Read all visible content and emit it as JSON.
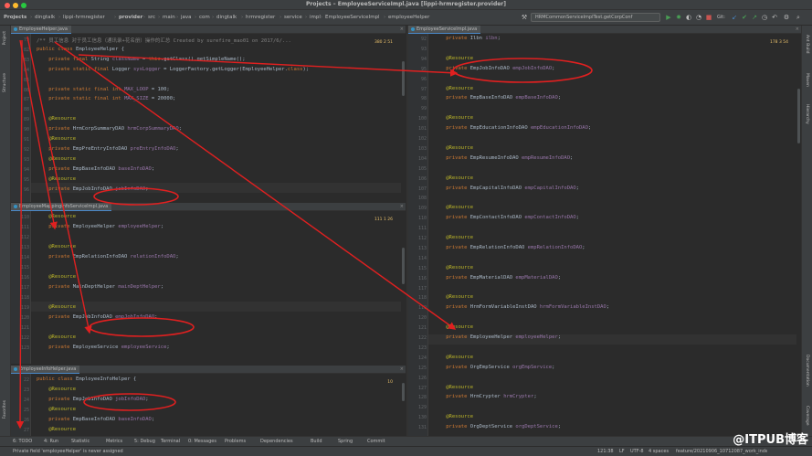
{
  "window": {
    "title": "Projects – EmployeeServiceImpl.java [lippi-hrmregister.provider]"
  },
  "breadcrumbs": [
    "Projects",
    "dingtalk",
    "lippi-hrmregister",
    "provider",
    "src",
    "main",
    "java",
    "com",
    "dingtalk",
    "hrmregister",
    "service",
    "impl",
    "EmployeeServiceImpl",
    "employeeHelper"
  ],
  "run_config": {
    "label": "HRMCommonServiceImplTest.getCorpConf"
  },
  "left_toolbar": {
    "project": "Project",
    "structure": "Structure",
    "favorites": "Favorites"
  },
  "right_toolbar": {
    "ant": "Ant Build",
    "maven": "Maven",
    "hierarchy": "Hierarchy",
    "docs": "Documentation",
    "coverage": "Coverage"
  },
  "pane1": {
    "tab": "EmployeeHelper.java",
    "inspect": "380  2  51",
    "lines": [
      {
        "n": "79",
        "code": "comment",
        "text": "/** 员工信息 对于员工信息（通讯录+花名册）操作的汇总 Created by surefire_mao01 on 2017/6/..."
      },
      {
        "n": "82",
        "code": "class",
        "text": "public class EmployeeHelper {"
      },
      {
        "n": "83",
        "code": "logger1",
        "text": "    private final String className = this.getClass().getSimpleName();"
      },
      {
        "n": "84",
        "code": "logger2",
        "text": "    private static final Logger sysLogger = LoggerFactory.getLogger(EmployeeHelper.class);"
      },
      {
        "n": "85",
        "code": "blank",
        "text": ""
      },
      {
        "n": "86",
        "code": "const1",
        "text": "    private static final int MAX_LOOP = 100;"
      },
      {
        "n": "87",
        "code": "const2",
        "text": "    private static final int MAX_SIZE = 20000;"
      },
      {
        "n": "88",
        "code": "blank",
        "text": ""
      },
      {
        "n": "89",
        "code": "anno",
        "text": "    @Resource"
      },
      {
        "n": "90",
        "code": "field",
        "text": "    private HrmCorpSummaryDAO hrmCorpSummaryDAO;"
      },
      {
        "n": "91",
        "code": "anno",
        "text": "    @Resource"
      },
      {
        "n": "92",
        "code": "field",
        "text": "    private EmpPreEntryInfoDAO preEntryInfoDAO;"
      },
      {
        "n": "93",
        "code": "anno",
        "text": "    @Resource"
      },
      {
        "n": "94",
        "code": "field",
        "text": "    private EmpBaseInfoDAO baseInfoDAO;"
      },
      {
        "n": "95",
        "code": "anno",
        "text": "    @Resource"
      },
      {
        "n": "96",
        "code": "field",
        "text": "    private EmpJobInfoDAO jobInfoDAO;"
      }
    ]
  },
  "pane2": {
    "tab": "EmployeeMappingInfoServiceImpl.java",
    "inspect": "111  1  26",
    "lines": [
      {
        "n": "110",
        "code": "anno",
        "text": "    @Resource"
      },
      {
        "n": "111",
        "code": "field",
        "text": "    private EmployeeHelper employeeHelper;"
      },
      {
        "n": "112",
        "code": "blank",
        "text": ""
      },
      {
        "n": "113",
        "code": "anno",
        "text": "    @Resource"
      },
      {
        "n": "114",
        "code": "field",
        "text": "    private EmpRelationInfoDAO relationInfoDAO;"
      },
      {
        "n": "115",
        "code": "blank",
        "text": ""
      },
      {
        "n": "116",
        "code": "anno",
        "text": "    @Resource"
      },
      {
        "n": "117",
        "code": "field",
        "text": "    private MainDeptHelper mainDeptHelper;"
      },
      {
        "n": "118",
        "code": "blank",
        "text": ""
      },
      {
        "n": "119",
        "code": "anno",
        "text": "    @Resource"
      },
      {
        "n": "120",
        "code": "field",
        "text": "    private EmpJobInfoDAO empJobInfoDAO;"
      },
      {
        "n": "121",
        "code": "blank",
        "text": ""
      },
      {
        "n": "122",
        "code": "anno",
        "text": "    @Resource"
      },
      {
        "n": "123",
        "code": "field",
        "text": "    private EmployeeService employeeService;"
      }
    ]
  },
  "pane3": {
    "tab": "EmployeeInfoHelper.java",
    "inspect": "10",
    "lines": [
      {
        "n": "22",
        "code": "class",
        "text": "public class EmployeeInfoHelper {"
      },
      {
        "n": "23",
        "code": "anno",
        "text": "    @Resource"
      },
      {
        "n": "24",
        "code": "field",
        "text": "    private EmpJobInfoDAO jobInfoDAO;"
      },
      {
        "n": "25",
        "code": "anno",
        "text": "    @Resource"
      },
      {
        "n": "26",
        "code": "field",
        "text": "    private EmpBaseInfoDAO baseInfoDAO;"
      },
      {
        "n": "27",
        "code": "anno",
        "text": "    @Resource"
      }
    ]
  },
  "pane4": {
    "tab": "EmployeeServiceImpl.java",
    "inspect": "178  3  54",
    "lines": [
      {
        "n": "92",
        "code": "field",
        "text": "    private Ilbn ilbn;"
      },
      {
        "n": "93",
        "code": "blank",
        "text": ""
      },
      {
        "n": "94",
        "code": "anno",
        "text": "    @Resource"
      },
      {
        "n": "95",
        "code": "field",
        "text": "    private EmpJobInfoDAO empJobInfoDAO;"
      },
      {
        "n": "96",
        "code": "blank",
        "text": ""
      },
      {
        "n": "97",
        "code": "anno",
        "text": "    @Resource"
      },
      {
        "n": "98",
        "code": "field",
        "text": "    private EmpBaseInfoDAO empBaseInfoDAO;"
      },
      {
        "n": "99",
        "code": "blank",
        "text": ""
      },
      {
        "n": "100",
        "code": "anno",
        "text": "    @Resource"
      },
      {
        "n": "101",
        "code": "field",
        "text": "    private EmpEducationInfoDAO empEducationInfoDAO;"
      },
      {
        "n": "102",
        "code": "blank",
        "text": ""
      },
      {
        "n": "103",
        "code": "anno",
        "text": "    @Resource"
      },
      {
        "n": "104",
        "code": "field",
        "text": "    private EmpResumeInfoDAO empResumeInfoDAO;"
      },
      {
        "n": "105",
        "code": "blank",
        "text": ""
      },
      {
        "n": "106",
        "code": "anno",
        "text": "    @Resource"
      },
      {
        "n": "107",
        "code": "field",
        "text": "    private EmpCapitalInfoDAO empCapitalInfoDAO;"
      },
      {
        "n": "108",
        "code": "blank",
        "text": ""
      },
      {
        "n": "109",
        "code": "anno",
        "text": "    @Resource"
      },
      {
        "n": "110",
        "code": "field",
        "text": "    private EmpContactInfoDAO empContactInfoDAO;"
      },
      {
        "n": "111",
        "code": "blank",
        "text": ""
      },
      {
        "n": "112",
        "code": "anno",
        "text": "    @Resource"
      },
      {
        "n": "113",
        "code": "field",
        "text": "    private EmpRelationInfoDAO empRelationInfoDAO;"
      },
      {
        "n": "114",
        "code": "blank",
        "text": ""
      },
      {
        "n": "115",
        "code": "anno",
        "text": "    @Resource"
      },
      {
        "n": "116",
        "code": "field",
        "text": "    private EmpMaterialDAO empMaterialDAO;"
      },
      {
        "n": "117",
        "code": "blank",
        "text": ""
      },
      {
        "n": "118",
        "code": "anno",
        "text": "    @Resource"
      },
      {
        "n": "119",
        "code": "field",
        "text": "    private HrmFormVariableInstDAO hrmFormVariableInstDAO;"
      },
      {
        "n": "120",
        "code": "blank",
        "text": ""
      },
      {
        "n": "121",
        "code": "anno",
        "text": "    @Resource"
      },
      {
        "n": "122",
        "code": "field",
        "text": "    private EmployeeHelper employeeHelper;"
      },
      {
        "n": "123",
        "code": "blank",
        "text": ""
      },
      {
        "n": "124",
        "code": "anno",
        "text": "    @Resource"
      },
      {
        "n": "125",
        "code": "field",
        "text": "    private OrgEmpService orgEmpService;"
      },
      {
        "n": "126",
        "code": "blank",
        "text": ""
      },
      {
        "n": "127",
        "code": "anno",
        "text": "    @Resource"
      },
      {
        "n": "128",
        "code": "field",
        "text": "    private HrmCrypter hrmCrypter;"
      },
      {
        "n": "129",
        "code": "blank",
        "text": ""
      },
      {
        "n": "130",
        "code": "anno",
        "text": "    @Resource"
      },
      {
        "n": "131",
        "code": "field",
        "text": "    private OrgDeptService orgDeptService;"
      }
    ]
  },
  "tool_windows": [
    "6: TODO",
    "4: Run",
    "Statistic",
    "Metrics",
    "5: Debug",
    "Terminal",
    "0: Messages",
    "Problems",
    "Dependencies",
    "Build",
    "Spring",
    "Commit"
  ],
  "status": {
    "message": "Private field 'employeeHelper' is never assigned",
    "position": "121:38",
    "line_sep": "LF",
    "encoding": "UTF-8",
    "indent": "4 spaces",
    "branch": "feature/20210906_10712087_work_index_page_1"
  },
  "watermark": "@ITPUB博客",
  "colors": {
    "editor_bg": "#2b2b2b",
    "keyword": "#cc7832",
    "annotation": "#bbb529",
    "field": "#9876aa",
    "comment": "#808080",
    "highlight_red": "#e02020"
  }
}
